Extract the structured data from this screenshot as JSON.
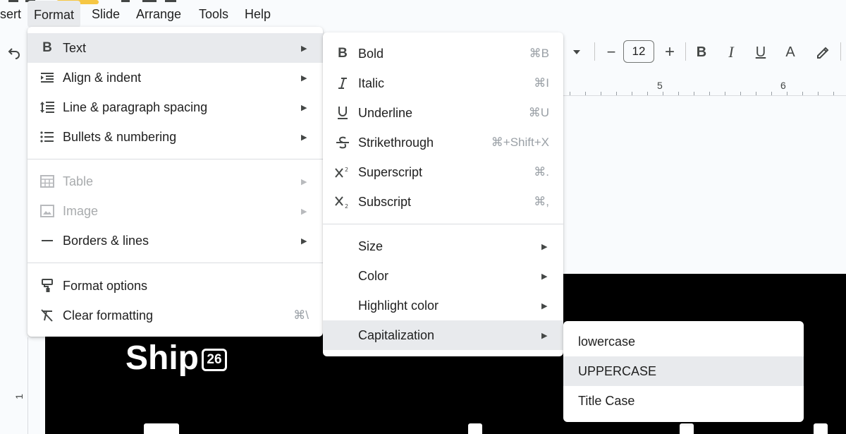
{
  "menubar": {
    "items": [
      {
        "label": "sert",
        "active": false
      },
      {
        "label": "Format",
        "active": true
      },
      {
        "label": "Slide",
        "active": false
      },
      {
        "label": "Arrange",
        "active": false
      },
      {
        "label": "Tools",
        "active": false
      },
      {
        "label": "Help",
        "active": false
      }
    ]
  },
  "toolbar": {
    "font_size": "12",
    "minus": "−",
    "plus": "+",
    "bold": "B",
    "italic": "I",
    "underline": "U",
    "text_color": "A"
  },
  "ruler": {
    "marks": [
      "5",
      "6"
    ],
    "vertical_mark": "1"
  },
  "slide": {
    "brand": "Ship",
    "badge": "26"
  },
  "format_menu": {
    "items": [
      {
        "label": "Text",
        "icon": "bold-b-icon",
        "submenu": true,
        "highlighted": true,
        "disabled": false
      },
      {
        "label": "Align & indent",
        "icon": "align-indent-icon",
        "submenu": true,
        "highlighted": false,
        "disabled": false
      },
      {
        "label": "Line & paragraph spacing",
        "icon": "line-spacing-icon",
        "submenu": true,
        "highlighted": false,
        "disabled": false
      },
      {
        "label": "Bullets & numbering",
        "icon": "bulleted-list-icon",
        "submenu": true,
        "highlighted": false,
        "disabled": false
      },
      {
        "label": "Table",
        "icon": "table-icon",
        "submenu": true,
        "highlighted": false,
        "disabled": true
      },
      {
        "label": "Image",
        "icon": "image-icon",
        "submenu": true,
        "highlighted": false,
        "disabled": true
      },
      {
        "label": "Borders & lines",
        "icon": "border-line-icon",
        "submenu": true,
        "highlighted": false,
        "disabled": false
      },
      {
        "label": "Format options",
        "icon": "paint-roller-icon",
        "submenu": false,
        "highlighted": false,
        "disabled": false
      },
      {
        "label": "Clear formatting",
        "icon": "clear-formatting-icon",
        "shortcut": "⌘\\",
        "submenu": false,
        "highlighted": false,
        "disabled": false
      }
    ]
  },
  "text_menu": {
    "items": [
      {
        "label": "Bold",
        "icon": "bold-icon",
        "shortcut": "⌘B"
      },
      {
        "label": "Italic",
        "icon": "italic-icon",
        "shortcut": "⌘I"
      },
      {
        "label": "Underline",
        "icon": "underline-icon",
        "shortcut": "⌘U"
      },
      {
        "label": "Strikethrough",
        "icon": "strikethrough-icon",
        "shortcut": "⌘+Shift+X"
      },
      {
        "label": "Superscript",
        "icon": "superscript-icon",
        "shortcut": "⌘."
      },
      {
        "label": "Subscript",
        "icon": "subscript-icon",
        "shortcut": "⌘,"
      },
      {
        "label": "Size",
        "submenu": true
      },
      {
        "label": "Color",
        "submenu": true
      },
      {
        "label": "Highlight color",
        "submenu": true
      },
      {
        "label": "Capitalization",
        "submenu": true,
        "highlighted": true
      }
    ]
  },
  "capitalization_menu": {
    "items": [
      {
        "label": "lowercase",
        "highlighted": false
      },
      {
        "label": "UPPERCASE",
        "highlighted": true
      },
      {
        "label": "Title Case",
        "highlighted": false
      }
    ]
  },
  "colors": {
    "menu_highlight": "#e8eaed",
    "slide_background": "#000000",
    "disabled_text": "#a8abad"
  }
}
